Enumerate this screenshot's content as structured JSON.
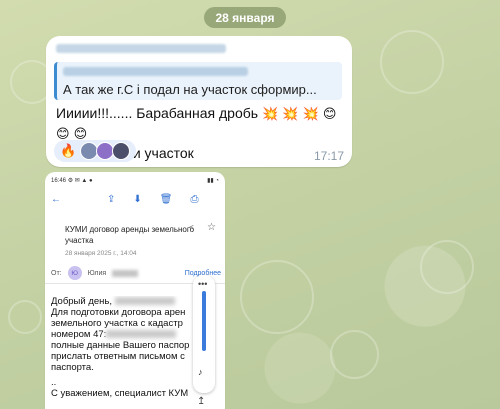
{
  "date_pill": "28 января",
  "message": {
    "quote_text": "А так же г.С   і подал на участок сформир...",
    "line1": "Иииии!!!...... Барабанная дробь",
    "line1_emoji": "💥 💥 💥 😊 😊 😊",
    "line2": "Согласовали участок",
    "reaction_emoji": "🔥",
    "time": "17:17"
  },
  "screenshot": {
    "status_time": "16:46",
    "status_icons": "⚙ ✉ ▲ ●",
    "status_right": "▮▮ ◔",
    "toolbar_back": "←",
    "toolbar_icons": [
      "⇪",
      "⬇",
      "🗑",
      "⎙"
    ],
    "subject": "КУМИ договор аренды земельного участка",
    "share_icon": "<",
    "star_icon": "☆",
    "mail_date": "28 января 2025 г., 14:04",
    "from_label": "От:",
    "from_initials": "Ю",
    "from_name": "Юлия",
    "details_link": "Подробнее",
    "body_lines": [
      "Добрый день,",
      "Для подготовки договора арен",
      "земельного участка с кадастр",
      "номером 47:",
      "полные данные Вашего паспор",
      "прислать ответным письмом с",
      "паспорта.",
      "..",
      "С уважением, специалист КУМ"
    ],
    "side_dots": "•••",
    "side_tiktok": "♪",
    "scroll_icon": "↥"
  },
  "colors": {
    "accent": "#3d8bd1",
    "bubble": "#ffffff",
    "time": "#8a9aa8",
    "link": "#2f6fd1"
  }
}
